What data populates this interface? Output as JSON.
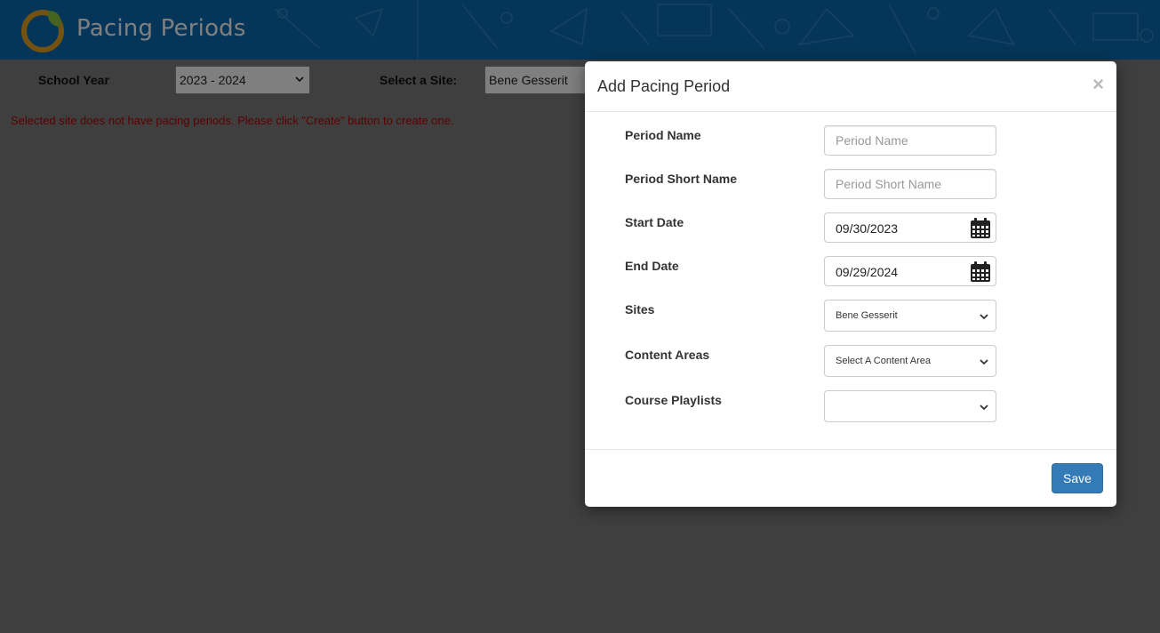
{
  "header": {
    "title": "Pacing Periods",
    "logo_icon": "leaf-circle-logo-icon",
    "colors": {
      "bar": "#0a6db3",
      "logo_ring": "#e8a524",
      "logo_leaf": "#8dc63f"
    }
  },
  "filters": {
    "school_year_label": "School Year",
    "school_year_value": "2023 - 2024",
    "site_label": "Select a Site:",
    "site_value": "Bene Gesserit"
  },
  "message": "Selected site does not have pacing periods. Please click \"Create\" button to create one.",
  "modal": {
    "title": "Add Pacing Period",
    "close_label": "×",
    "fields": {
      "period_name": {
        "label": "Period Name",
        "placeholder": "Period Name",
        "value": ""
      },
      "period_short_name": {
        "label": "Period Short Name",
        "placeholder": "Period Short Name",
        "value": ""
      },
      "start_date": {
        "label": "Start Date",
        "value": "09/30/2023"
      },
      "end_date": {
        "label": "End Date",
        "value": "09/29/2024"
      },
      "sites": {
        "label": "Sites",
        "value": "Bene Gesserit"
      },
      "content_areas": {
        "label": "Content Areas",
        "value": "Select A Content Area"
      },
      "course_playlists": {
        "label": "Course Playlists",
        "value": ""
      }
    },
    "save_label": "Save",
    "colors": {
      "save_button": "#337ab7"
    }
  }
}
